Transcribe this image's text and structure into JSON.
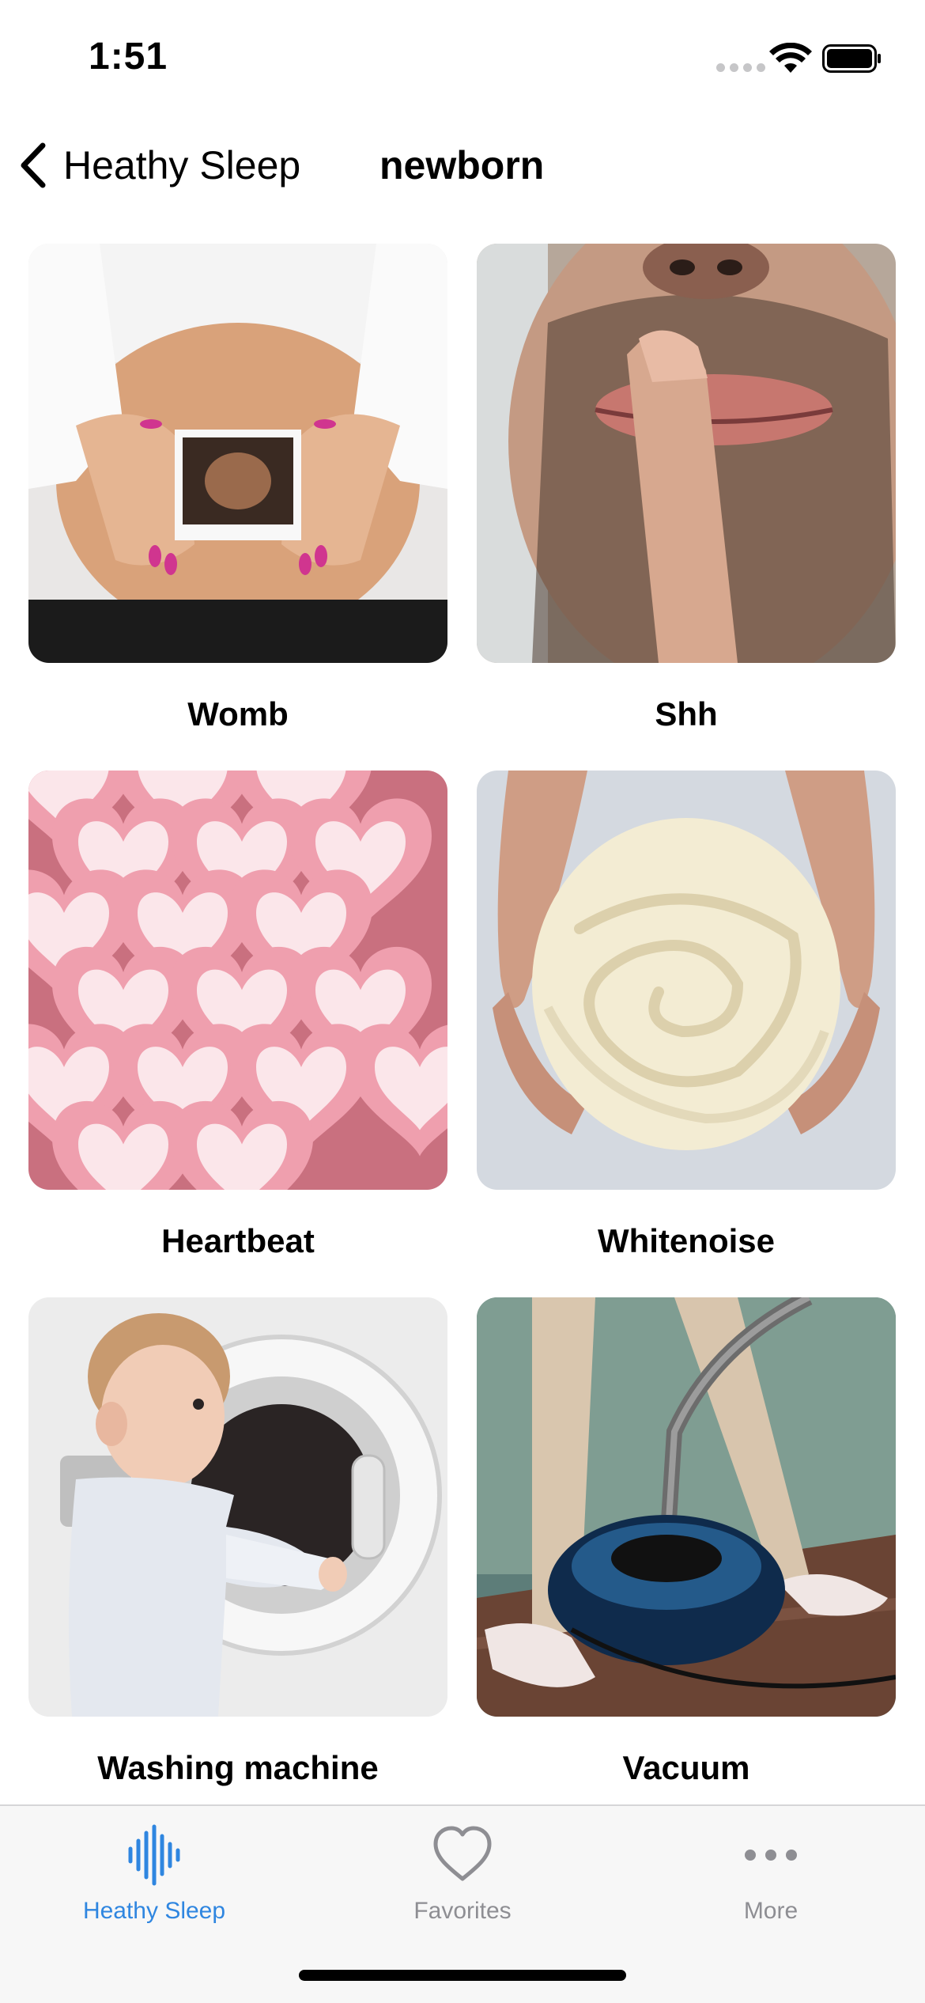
{
  "status_bar": {
    "time": "1:51"
  },
  "nav": {
    "back_label": "Heathy Sleep",
    "title": "newborn"
  },
  "sounds": [
    {
      "label": "Womb"
    },
    {
      "label": "Shh"
    },
    {
      "label": "Heartbeat"
    },
    {
      "label": "Whitenoise"
    },
    {
      "label": "Washing machine"
    },
    {
      "label": "Vacuum"
    }
  ],
  "tab_bar": {
    "tabs": [
      {
        "label": "Heathy Sleep",
        "icon": "waveform-icon",
        "active": true
      },
      {
        "label": "Favorites",
        "icon": "heart-icon",
        "active": false
      },
      {
        "label": "More",
        "icon": "more-dots-icon",
        "active": false
      }
    ]
  },
  "colors": {
    "accent": "#2f86e0",
    "inactive": "#8e8e93",
    "tab_bar_bg": "#f7f7f7"
  }
}
